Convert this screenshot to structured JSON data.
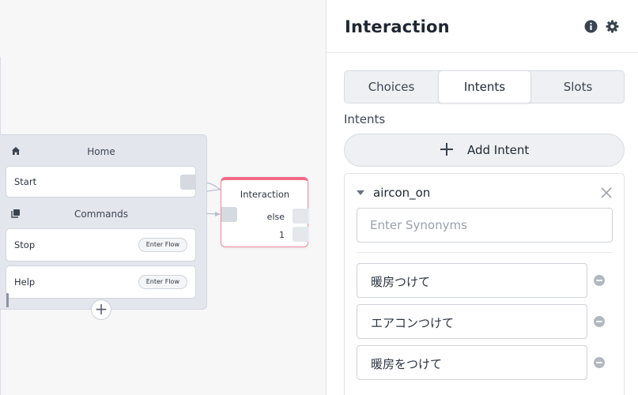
{
  "canvas": {
    "home_group": {
      "title": "Home",
      "icon": "home-icon",
      "nodes": [
        {
          "label": "Start"
        }
      ]
    },
    "commands_group": {
      "title": "Commands",
      "icon": "stack-icon",
      "nodes": [
        {
          "label": "Stop",
          "action": "Enter Flow"
        },
        {
          "label": "Help",
          "action": "Enter Flow"
        }
      ]
    },
    "add_node_label": "+",
    "interaction_node": {
      "title": "Interaction",
      "outputs": [
        "else",
        "1"
      ]
    }
  },
  "panel": {
    "title": "Interaction",
    "info_icon": "info-icon",
    "settings_icon": "gear-icon",
    "tabs": [
      {
        "label": "Choices",
        "active": false
      },
      {
        "label": "Intents",
        "active": true
      },
      {
        "label": "Slots",
        "active": false
      }
    ],
    "section_label": "Intents",
    "add_intent_label": "Add Intent",
    "intent": {
      "name": "aircon_on",
      "synonym_placeholder": "Enter Synonyms",
      "synonyms": [
        "暖房つけて",
        "エアコンつけて",
        "暖房をつけて"
      ]
    }
  },
  "colors": {
    "accent_node_border": "#f06a88",
    "panel_bg": "#ffffff",
    "canvas_bg": "#f7f7f8",
    "remove_icon": "#b3b8c0"
  }
}
